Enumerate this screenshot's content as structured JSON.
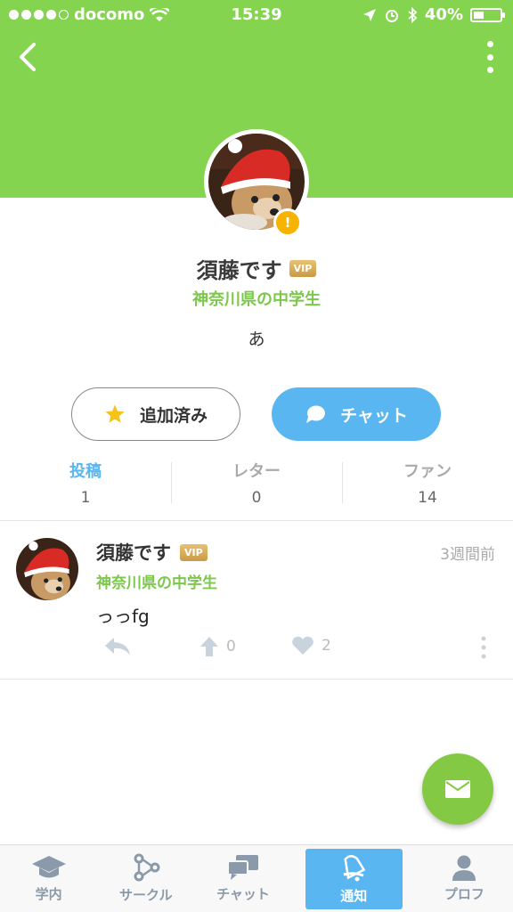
{
  "status_bar": {
    "carrier": "docomo",
    "time": "15:39",
    "battery": "40%",
    "battery_level": 0.4
  },
  "colors": {
    "header": "#84d44f",
    "accent_blue": "#5ab6f0",
    "school_green": "#7cc84b",
    "warning": "#f6b400"
  },
  "profile": {
    "name": "須藤です",
    "vip_label": "VIP",
    "school": "神奈川県の中学生",
    "bio": "あ",
    "warning_badge": "!"
  },
  "actions": {
    "added_label": "追加済み",
    "chat_label": "チャット"
  },
  "stats": [
    {
      "label": "投稿",
      "value": "1",
      "active": true
    },
    {
      "label": "レター",
      "value": "0",
      "active": false
    },
    {
      "label": "ファン",
      "value": "14",
      "active": false
    }
  ],
  "post": {
    "author": "須藤です",
    "vip_label": "VIP",
    "school": "神奈川県の中学生",
    "time": "3週間前",
    "body": "っっfg",
    "upvotes": "0",
    "likes": "2"
  },
  "tabbar": {
    "items": [
      {
        "label": "学内",
        "icon": "graduation-cap-icon"
      },
      {
        "label": "サークル",
        "icon": "circle-network-icon"
      },
      {
        "label": "チャット",
        "icon": "chat-bubbles-icon"
      },
      {
        "label": "通知",
        "icon": "bell-icon",
        "active": true
      },
      {
        "label": "プロフ",
        "icon": "person-icon"
      }
    ]
  }
}
